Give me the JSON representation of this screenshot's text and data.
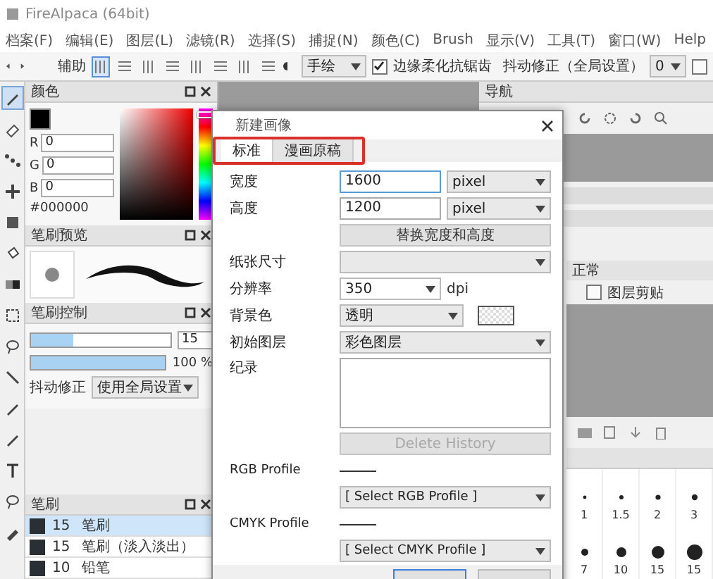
{
  "window": {
    "title": "FireAlpaca (64bit)"
  },
  "menu": [
    "档案(F)",
    "编辑(E)",
    "图层(L)",
    "滤镜(R)",
    "选择(S)",
    "捕捉(N)",
    "颜色(C)",
    "Brush",
    "显示(V)",
    "工具(T)",
    "窗口(W)",
    "Help"
  ],
  "toolbar": {
    "label": "辅助",
    "snaps": [
      {
        "selected": true
      },
      {
        "selected": false
      },
      {
        "selected": false
      },
      {
        "selected": false
      },
      {
        "selected": false
      },
      {
        "selected": false
      },
      {
        "selected": false
      },
      {
        "selected": false
      }
    ],
    "stroke_mode": "手绘",
    "antialias": {
      "label": "边缘柔化抗锯齿",
      "checked": true
    },
    "stabilizer": {
      "label": "抖动修正（全局设置）",
      "value": "0"
    },
    "extra": {
      "checked": false
    }
  },
  "tools": [
    {
      "kind": "pen",
      "selected": true
    },
    {
      "kind": "eraser",
      "selected": false
    },
    {
      "kind": "dots",
      "selected": false
    },
    {
      "kind": "move",
      "selected": false
    },
    {
      "kind": "fill",
      "selected": false
    },
    {
      "kind": "bucket",
      "selected": false
    },
    {
      "kind": "gradient",
      "selected": false
    },
    {
      "kind": "select",
      "selected": false
    },
    {
      "kind": "lasso",
      "selected": false
    },
    {
      "kind": "wand",
      "selected": false
    },
    {
      "kind": "pen",
      "selected": false
    },
    {
      "kind": "pen",
      "selected": false
    },
    {
      "kind": "text",
      "selected": false
    },
    {
      "kind": "lasso",
      "selected": false
    },
    {
      "kind": "dropper",
      "selected": false
    }
  ],
  "color_panel": {
    "title": "颜色",
    "channels": [
      {
        "label": "R",
        "value": "0"
      },
      {
        "label": "G",
        "value": "0"
      },
      {
        "label": "B",
        "value": "0"
      }
    ],
    "hex": "#000000",
    "hue": {
      "level": 0.02
    }
  },
  "brush_preview": {
    "title": "笔刷预览"
  },
  "brush_control": {
    "title": "笔刷控制",
    "size": {
      "level": 0.3,
      "value": "15"
    },
    "opacity": {
      "level": 1,
      "value": "100 %"
    },
    "stabilizer": {
      "label": "抖动修正",
      "value": "使用全局设置"
    }
  },
  "brush_list": {
    "title": "笔刷",
    "items": [
      {
        "size": "15",
        "name": "笔刷",
        "selected": true
      },
      {
        "size": "15",
        "name": "笔刷（淡入淡出）",
        "selected": false
      },
      {
        "size": "10",
        "name": "铅笔",
        "selected": false
      }
    ]
  },
  "navigator": {
    "title": "导航"
  },
  "layers": {
    "blend": "正常",
    "clipping": {
      "label": "图层剪贴",
      "checked": false
    }
  },
  "brush_sizes": [
    "1",
    "1.5",
    "2",
    "3",
    "7",
    "10",
    "15",
    "15"
  ],
  "dialog": {
    "title": "新建画像",
    "tabs": [
      {
        "label": "标准",
        "selected": true
      },
      {
        "label": "漫画原稿",
        "selected": false
      }
    ],
    "width": {
      "label": "宽度",
      "value": "1600",
      "unit": "pixel"
    },
    "height": {
      "label": "高度",
      "value": "1200",
      "unit": "pixel"
    },
    "swap_button": "替换宽度和高度",
    "paper": {
      "label": "纸张尺寸"
    },
    "resolution": {
      "label": "分辨率",
      "value": "350",
      "unit": "dpi"
    },
    "background": {
      "label": "背景色",
      "value": "透明"
    },
    "initial_layer": {
      "label": "初始图层",
      "value": "彩色图层"
    },
    "history": {
      "label": "纪录"
    },
    "delete_button": {
      "label": "Delete History",
      "disabled": true
    },
    "rgb": {
      "label": "RGB Profile",
      "value": "[ Select RGB Profile ]"
    },
    "cmyk": {
      "label": "CMYK Profile",
      "value": "[ Select CMYK Profile ]"
    }
  }
}
